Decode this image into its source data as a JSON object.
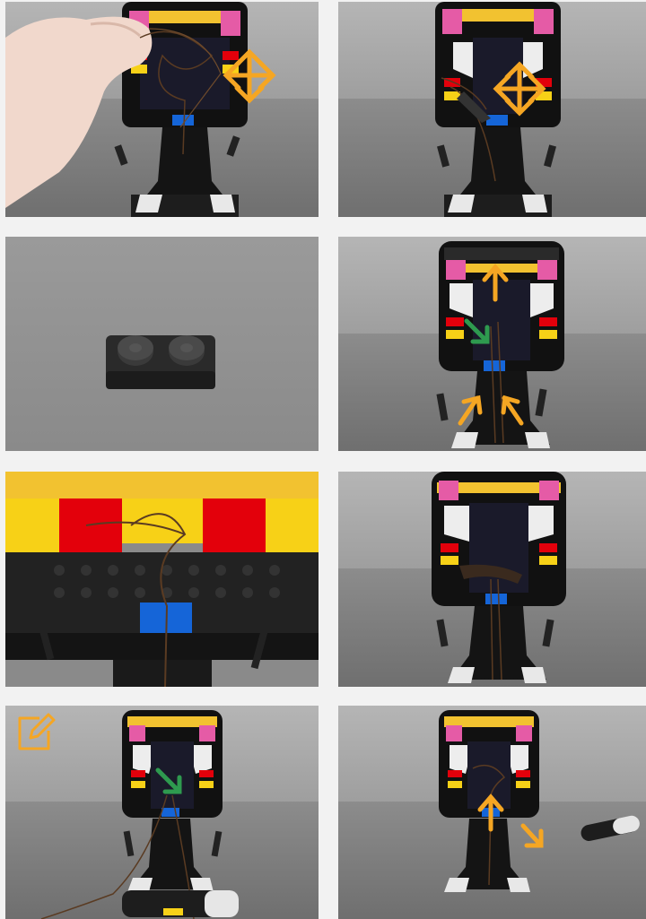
{
  "panels": [
    {
      "id": 1,
      "arrows": [
        "expand-arrows"
      ],
      "accent": "#f5a623"
    },
    {
      "id": 2,
      "arrows": [
        "expand-arrows"
      ],
      "accent": "#f5a623"
    },
    {
      "id": 3,
      "arrows": [],
      "accent": "#f5a623"
    },
    {
      "id": 4,
      "arrows": [
        "up-arrow",
        "down-right-arrow",
        "up-left-arrow",
        "up-right-arrow"
      ],
      "accent": "#f5a623",
      "secondary": "#2e9a4f"
    },
    {
      "id": 5,
      "arrows": [],
      "accent": "#f5a623"
    },
    {
      "id": 6,
      "arrows": [],
      "accent": "#f5a623"
    },
    {
      "id": 7,
      "arrows": [
        "down-right-arrow"
      ],
      "icon": "edit-icon",
      "accent": "#f5a623",
      "secondary": "#2e9a4f"
    },
    {
      "id": 8,
      "arrows": [
        "up-arrow",
        "down-right-arrow"
      ],
      "accent": "#f5a623"
    }
  ],
  "colors": {
    "orange": "#f5a623",
    "green": "#2e9a4f",
    "lego_blue": "#1565d8",
    "lego_red": "#e3000b",
    "lego_yellow": "#f7d117",
    "lego_pink": "#e85aa3"
  }
}
